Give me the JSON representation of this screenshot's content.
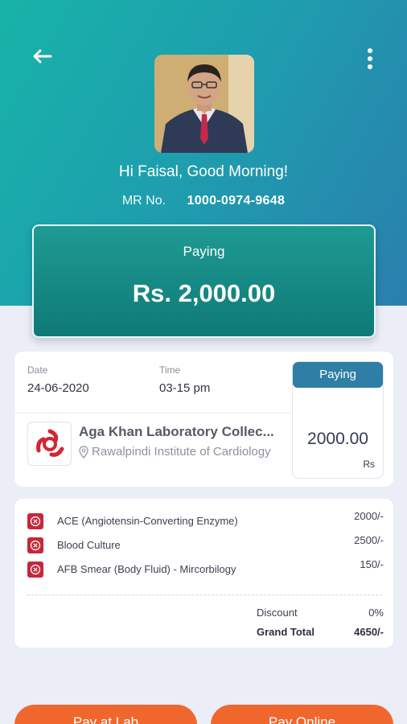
{
  "header": {
    "greeting": "Hi Faisal, Good Morning!",
    "mr_label": "MR No.",
    "mr_number": "1000-0974-9648"
  },
  "payment": {
    "label": "Paying",
    "amount": "Rs. 2,000.00"
  },
  "details": {
    "date_label": "Date",
    "date_value": "24-06-2020",
    "time_label": "Time",
    "time_value": "03-15 pm",
    "paying_badge": "Paying",
    "paying_amount": "2000.00",
    "currency": "Rs",
    "lab_name": "Aga Khan Laboratory Collec...",
    "lab_location": "Rawalpindi Institute of Cardiology"
  },
  "tests": [
    {
      "name": "ACE (Angiotensin-Converting Enzyme)",
      "price": "2000/-"
    },
    {
      "name": "Blood Culture",
      "price": "2500/-"
    },
    {
      "name": "AFB Smear (Body Fluid) - Mircorbilogy",
      "price": "150/-"
    }
  ],
  "summary": {
    "discount_label": "Discount",
    "discount_value": "0%",
    "grand_total_label": "Grand Total",
    "grand_total_value": "4650/-"
  },
  "actions": {
    "pay_at_lab": "Pay at Lab",
    "pay_online": "Pay Online"
  },
  "colors": {
    "accent": "#1f9a94",
    "badge": "#2e7ea6",
    "action": "#f0672e",
    "test_icon": "#c62839"
  }
}
